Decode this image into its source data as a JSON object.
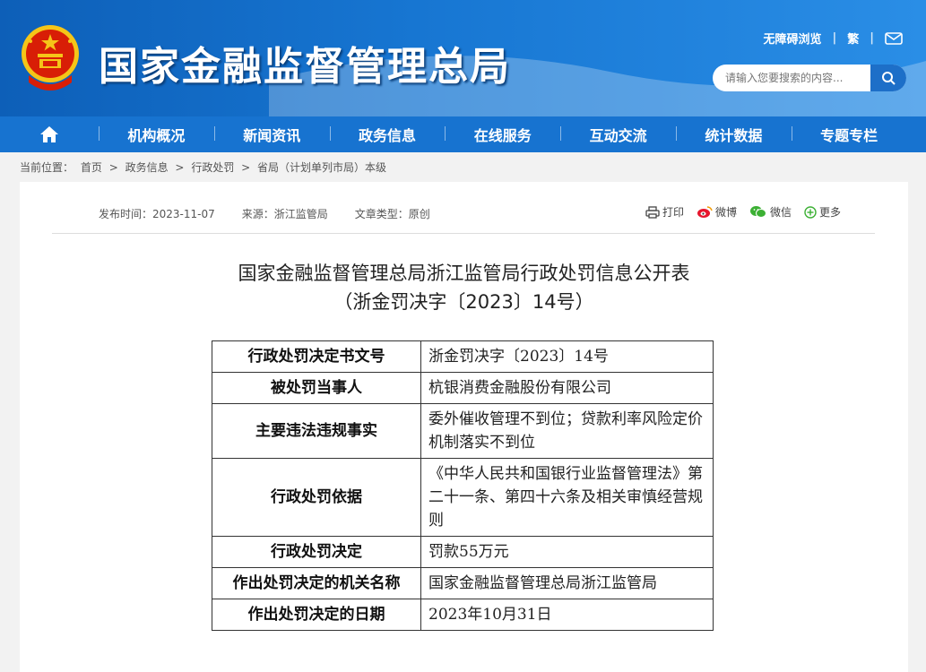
{
  "header": {
    "site_title": "国家金融监督管理总局",
    "accessibility_link": "无障碍浏览",
    "traditional_link": "繁",
    "search_placeholder": "请输入您要搜索的内容..."
  },
  "nav": {
    "items": [
      {
        "label": "机构概况"
      },
      {
        "label": "新闻资讯"
      },
      {
        "label": "政务信息"
      },
      {
        "label": "在线服务"
      },
      {
        "label": "互动交流"
      },
      {
        "label": "统计数据"
      },
      {
        "label": "专题专栏"
      }
    ]
  },
  "breadcrumb": {
    "prefix": "当前位置：",
    "items": [
      "首页",
      "政务信息",
      "行政处罚",
      "省局（计划单列市局）本级"
    ],
    "separator": ">"
  },
  "article": {
    "publish_time": "发布时间：2023-11-07",
    "source": "来源：浙江监管局",
    "doc_type": "文章类型：原创",
    "share": {
      "print": "打印",
      "weibo": "微博",
      "wechat": "微信",
      "more": "更多"
    },
    "title_line1": "国家金融监督管理总局浙江监管局行政处罚信息公开表",
    "title_line2": "（浙金罚决字〔2023〕14号）"
  },
  "table": {
    "rows": [
      {
        "key": "行政处罚决定书文号",
        "value": "浙金罚决字〔2023〕14号"
      },
      {
        "key": "被处罚当事人",
        "value": "杭银消费金融股份有限公司"
      },
      {
        "key": "主要违法违规事实",
        "value": "委外催收管理不到位；贷款利率风险定价机制落实不到位"
      },
      {
        "key": "行政处罚依据",
        "value": "《中华人民共和国银行业监督管理法》第二十一条、第四十六条及相关审慎经营规则"
      },
      {
        "key": "行政处罚决定",
        "value": "罚款55万元"
      },
      {
        "key": "作出处罚决定的机关名称",
        "value": "国家金融监督管理总局浙江监管局"
      },
      {
        "key": "作出处罚决定的日期",
        "value": "2023年10月31日"
      }
    ]
  },
  "colors": {
    "header_blue": "#1776d2",
    "nav_blue": "#1773d0",
    "emblem_red": "#d81e06",
    "emblem_gold": "#f5c518"
  }
}
